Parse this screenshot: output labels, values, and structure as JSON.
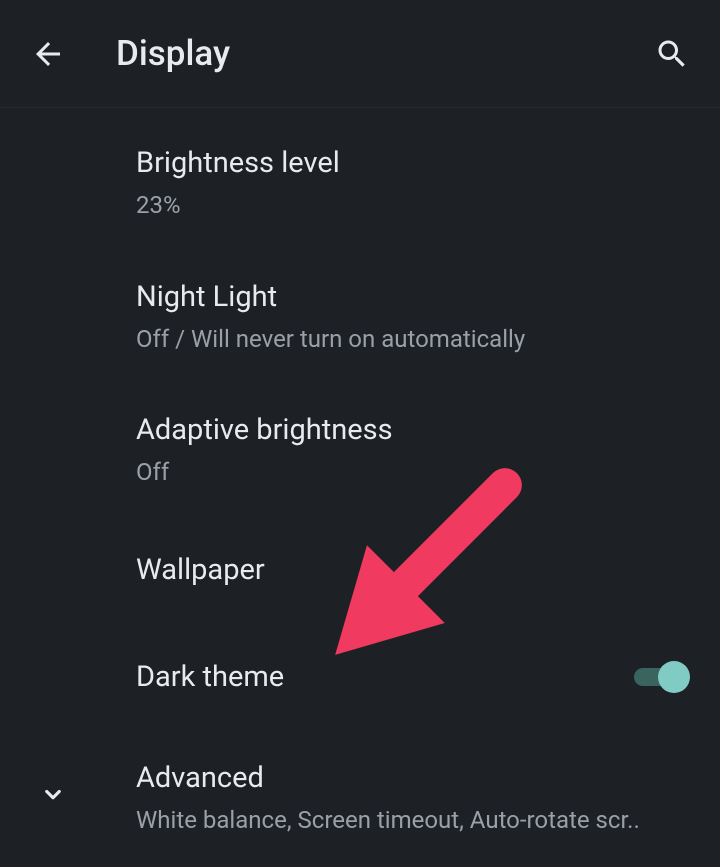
{
  "header": {
    "title": "Display"
  },
  "settings": {
    "brightness": {
      "title": "Brightness level",
      "value": "23%"
    },
    "nightLight": {
      "title": "Night Light",
      "subtitle": "Off / Will never turn on automatically"
    },
    "adaptiveBrightness": {
      "title": "Adaptive brightness",
      "subtitle": "Off"
    },
    "wallpaper": {
      "title": "Wallpaper"
    },
    "darkTheme": {
      "title": "Dark theme",
      "enabled": true
    },
    "advanced": {
      "title": "Advanced",
      "subtitle": "White balance, Screen timeout, Auto-rotate scr.."
    }
  },
  "colors": {
    "background": "#1d2125",
    "text": "#e8eaed",
    "subtext": "#9aa0a6",
    "accent": "#80cbc4",
    "arrow": "#f03a5f"
  }
}
